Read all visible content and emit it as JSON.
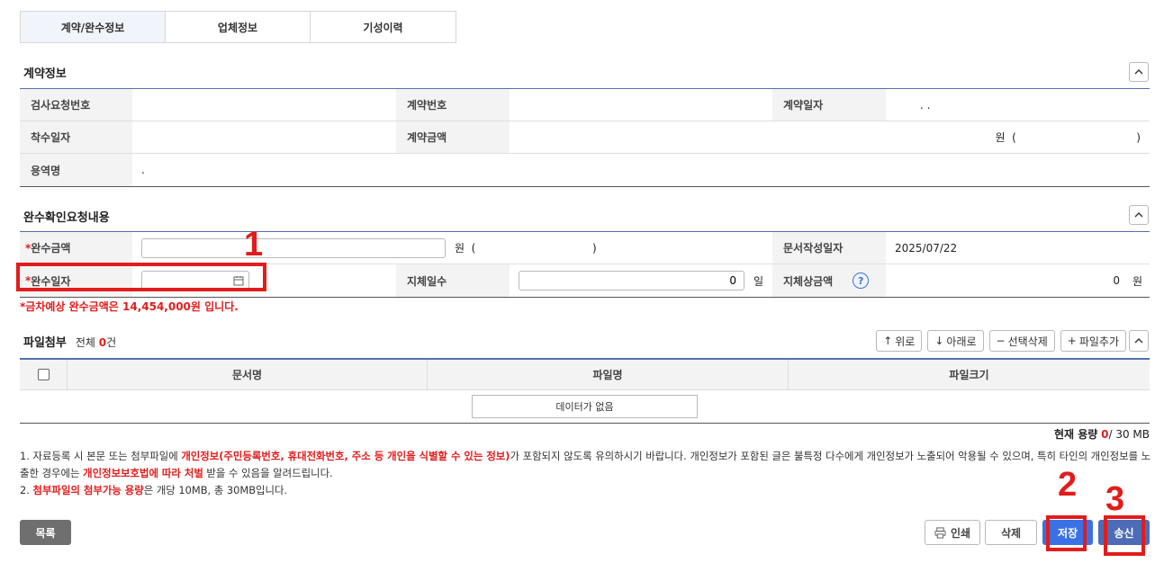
{
  "tabs": [
    {
      "label": "계약/완수정보",
      "active": true
    },
    {
      "label": "업체정보",
      "active": false
    },
    {
      "label": "기성이력",
      "active": false
    }
  ],
  "contract_section": {
    "title": "계약정보",
    "inspection_no_label": "검사요청번호",
    "inspection_no_value": "",
    "contract_no_label": "계약번호",
    "contract_no_value": "",
    "contract_date_label": "계약일자",
    "contract_date_value": ".   .",
    "start_date_label": "착수일자",
    "start_date_value": "",
    "contract_amount_label": "계약금액",
    "contract_amount_value": "원  (                                   )",
    "service_name_label": "용역명",
    "service_name_value": "."
  },
  "completion_section": {
    "title": "완수확인요청내용",
    "required_mark": "*",
    "amount_label": "완수금액",
    "amount_value": "",
    "amount_unit": "원  (                                  )",
    "doc_date_label": "문서작성일자",
    "doc_date_value": "2025/07/22",
    "completion_date_label": "완수일자",
    "completion_date_value": "",
    "delay_days_label": "지체일수",
    "delay_days_value": "0",
    "delay_days_unit": "일",
    "delay_penalty_label": "지체상금액",
    "delay_penalty_help": "?",
    "delay_penalty_value": "0",
    "delay_penalty_unit": "원",
    "notice": "*금차예상 완수금액은 14,454,000원 입니다."
  },
  "annotations": [
    "1",
    "2",
    "3"
  ],
  "file_section": {
    "title": "파일첨부",
    "total_prefix": "전체",
    "total_count": "0",
    "total_suffix": "건",
    "buttons": {
      "up": "위로",
      "down": "아래로",
      "delete_selected": "선택삭제",
      "add_file": "파일추가"
    },
    "columns": [
      "문서명",
      "파일명",
      "파일크기"
    ],
    "empty_text": "데이터가 없음",
    "capacity_label": "현재 용량",
    "capacity_used": "0",
    "capacity_total": "/ 30 MB"
  },
  "notes": {
    "n1_a": "1. 자료등록 시 본문 또는 첨부파일에 ",
    "n1_b": "개인정보(주민등록번호, 휴대전화번호, 주소 등 개인을 식별할 수 있는 정보)",
    "n1_c": "가 포함되지 않도록 유의하시기 바랍니다. 개인정보가 포함된 글은 불특정 다수에게 개인정보가 노출되어 악용될 수 있으며, 특히 타인의 개인정보를 노출한 경우에는 ",
    "n1_d": "개인정보보호법에 따라 처벌",
    "n1_e": " 받을 수 있음을 알려드립니다.",
    "n2_a": "2. ",
    "n2_b": "첨부파일의 첨부가능 용량",
    "n2_c": "은 개당 10MB, 총 30MB입니다."
  },
  "footer": {
    "list": "목록",
    "print": "인쇄",
    "delete": "삭제",
    "save": "저장",
    "send": "송신"
  },
  "colors": {
    "accent_blue": "#3a72e6",
    "navy": "#4d6bb7",
    "annotation_red": "#e21c1c"
  }
}
